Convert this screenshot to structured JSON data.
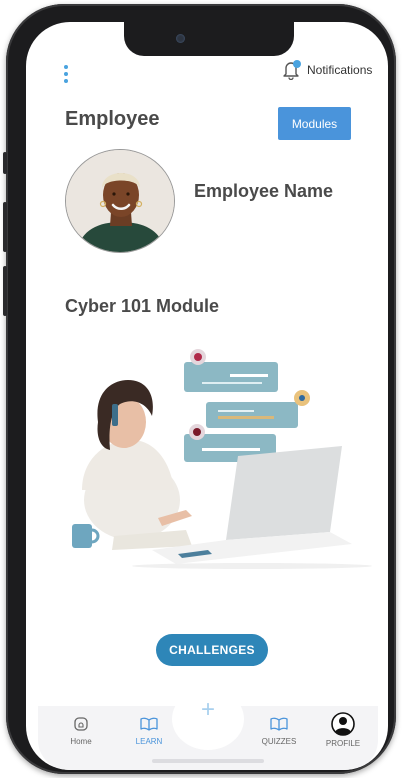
{
  "header": {
    "notifications_label": "Notifications"
  },
  "profile": {
    "section_title": "Employee",
    "modules_label": "Modules",
    "employee_name": "Employee Name"
  },
  "module": {
    "title": "Cyber 101 Module",
    "challenges_label": "CHALLENGES"
  },
  "nav": {
    "items": [
      {
        "label": "Home",
        "icon": "home-icon"
      },
      {
        "label": "LEARN",
        "icon": "book-icon"
      },
      {
        "label": "QUIZZES",
        "icon": "book-icon"
      },
      {
        "label": "PROFILE",
        "icon": "profile-icon"
      }
    ],
    "center_icon": "plus-icon",
    "active": "LEARN"
  },
  "colors": {
    "accent": "#4a94db",
    "challenges": "#2e86b8",
    "text": "#4a4a4a"
  }
}
